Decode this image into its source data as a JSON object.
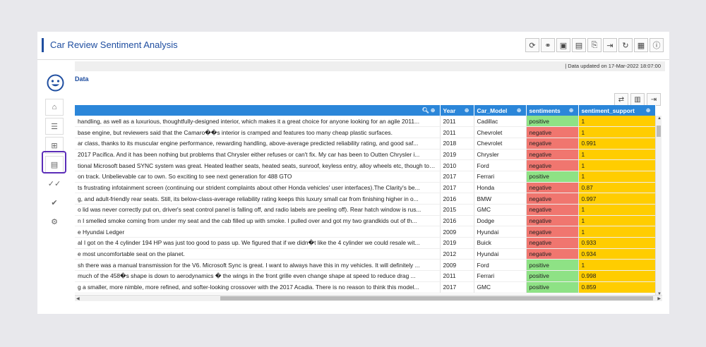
{
  "app": {
    "title": "Car Review Sentiment Analysis"
  },
  "toolbar": {
    "icons": [
      "refresh-icon",
      "link-icon",
      "save-icon",
      "save-as-icon",
      "export-icon",
      "logout-icon",
      "help-icon",
      "grid-icon",
      "info-icon"
    ]
  },
  "status": {
    "text": "|   Data updated on 17-Mar-2022 18:07:00"
  },
  "nav": {
    "icons": [
      "home-icon",
      "list-icon",
      "hierarchy-icon",
      "table-icon",
      "double-check-icon",
      "check-icon",
      "gear-icon"
    ]
  },
  "section": {
    "title": "Data"
  },
  "table": {
    "headers": [
      "",
      "Year",
      "Car_Model",
      "sentiments",
      "sentiment_support"
    ],
    "rows": [
      {
        "review": "handling, as well as a luxurious, thoughtfully-designed interior, which makes it a great choice for anyone looking for an agile 2011...",
        "year": "2011",
        "model": "Cadillac",
        "sentiment": "positive",
        "support": "1"
      },
      {
        "review": "base engine, but reviewers said that the Camaro��s interior is cramped and features too many cheap plastic surfaces.",
        "year": "2011",
        "model": "Chevrolet",
        "sentiment": "negative",
        "support": "1"
      },
      {
        "review": "ar class, thanks to its muscular engine performance, rewarding handling, above-average predicted reliability rating, and good saf...",
        "year": "2018",
        "model": "Chevrolet",
        "sentiment": "negative",
        "support": "0.991"
      },
      {
        "review": "2017 Pacifica. And it has been nothing but problems that Chrysler either refuses or can't fix. My car has been to Outten Chrysler i...",
        "year": "2019",
        "model": "Chrysler",
        "sentiment": "negative",
        "support": "1"
      },
      {
        "review": "tional Microsoft based SYNC system was great. Heated leather seats, heated seats, sunroof, keyless entry, alloy wheels etc, though to me as ...",
        "year": "2010",
        "model": "Ford",
        "sentiment": "negative",
        "support": "1"
      },
      {
        "review": "on track. Unbelievable car to own. So exciting to see next generation for 488 GTO",
        "year": "2017",
        "model": "Ferrari",
        "sentiment": "positive",
        "support": "1"
      },
      {
        "review": "ts frustrating infotainment screen (continuing our strident complaints about other Honda vehicles' user interfaces).The Clarity's be...",
        "year": "2017",
        "model": "Honda",
        "sentiment": "negative",
        "support": "0.87"
      },
      {
        "review": "g, and adult-friendly rear seats. Still, its below-class-average reliability rating keeps this luxury small car from finishing higher in o...",
        "year": "2016",
        "model": "BMW",
        "sentiment": "negative",
        "support": "0.997"
      },
      {
        "review": "o lid was never correctly put on, driver's seat control panel is falling off, and radio labels are peeling off). Rear hatch window is rus...",
        "year": "2015",
        "model": "GMC",
        "sentiment": "negative",
        "support": "1"
      },
      {
        "review": "n I smelled smoke coming from under my seat and the cab filled up with smoke. I pulled over and got my two grandkids out of th...",
        "year": "2016",
        "model": "Dodge",
        "sentiment": "negative",
        "support": "1"
      },
      {
        "review": "e Hyundai Ledger",
        "year": "2009",
        "model": "Hyundai",
        "sentiment": "negative",
        "support": "1"
      },
      {
        "review": "al I got on the 4 cylinder 194 HP was just too good to pass up. We figured that if we didn�t like the 4 cylinder we could resale wit...",
        "year": "2019",
        "model": "Buick",
        "sentiment": "negative",
        "support": "0.933"
      },
      {
        "review": "e most uncomfortable seat on the planet.",
        "year": "2012",
        "model": "Hyundai",
        "sentiment": "negative",
        "support": "0.934"
      },
      {
        "review": "sh there was a manual transmission for the V6. Microsoft Sync is great. I want to always have this in my vehicles. It will definitely ...",
        "year": "2009",
        "model": "Ford",
        "sentiment": "positive",
        "support": "1"
      },
      {
        "review": "much of the 458�s shape is down to aerodynamics � the wings in the front grille even change shape at speed to reduce drag ...",
        "year": "2011",
        "model": "Ferrari",
        "sentiment": "positive",
        "support": "0.998"
      },
      {
        "review": "g a smaller, more nimble, more refined, and softer-looking crossover with the 2017 Acadia. There is no reason to think this model...",
        "year": "2017",
        "model": "GMC",
        "sentiment": "positive",
        "support": "0.859"
      }
    ]
  },
  "colors": {
    "accent": "#1f4ea0",
    "header_bg": "#2b86d9",
    "negative": "#f0766f",
    "positive": "#8ee285",
    "support": "#ffcd00",
    "highlight": "#5b2db8"
  }
}
